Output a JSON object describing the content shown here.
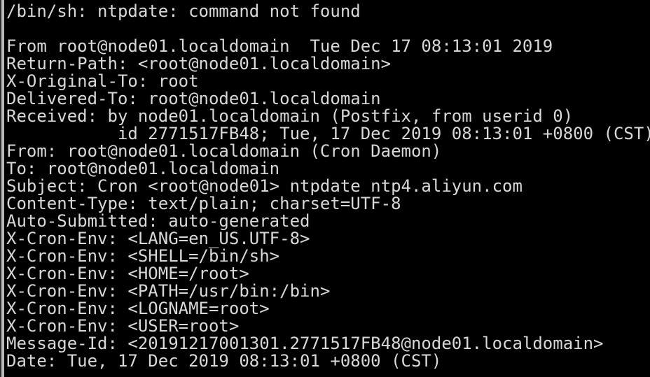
{
  "terminal": {
    "background_color": "#000000",
    "foreground_color": "#d8d8d8",
    "gutter_color": "#b8b8b8",
    "lines": [
      {
        "text": "/bin/sh: ntpdate: command not found",
        "name": "output-line-error"
      },
      {
        "text": "",
        "name": "output-line-blank"
      },
      {
        "text": "From root@node01.localdomain  Tue Dec 17 08:13:01 2019",
        "name": "output-line-from-envelope"
      },
      {
        "text": "Return-Path: <root@node01.localdomain>",
        "name": "output-line-return-path"
      },
      {
        "text": "X-Original-To: root",
        "name": "output-line-x-original-to"
      },
      {
        "text": "Delivered-To: root@node01.localdomain",
        "name": "output-line-delivered-to"
      },
      {
        "text": "Received: by node01.localdomain (Postfix, from userid 0)",
        "name": "output-line-received"
      },
      {
        "text": "           id 2771517FB48; Tue, 17 Dec 2019 08:13:01 +0800 (CST)",
        "name": "output-line-received-id"
      },
      {
        "text": "From: root@node01.localdomain (Cron Daemon)",
        "name": "output-line-from-header"
      },
      {
        "text": "To: root@node01.localdomain",
        "name": "output-line-to-header"
      },
      {
        "text": "Subject: Cron <root@node01> ntpdate ntp4.aliyun.com",
        "name": "output-line-subject"
      },
      {
        "text": "Content-Type: text/plain; charset=UTF-8",
        "name": "output-line-content-type"
      },
      {
        "text": "Auto-Submitted: auto-generated",
        "name": "output-line-auto-submitted"
      },
      {
        "text": "X-Cron-Env: <LANG=en_US.UTF-8>",
        "name": "output-line-cron-env-lang"
      },
      {
        "text": "X-Cron-Env: <SHELL=/bin/sh>",
        "name": "output-line-cron-env-shell"
      },
      {
        "text": "X-Cron-Env: <HOME=/root>",
        "name": "output-line-cron-env-home"
      },
      {
        "text": "X-Cron-Env: <PATH=/usr/bin:/bin>",
        "name": "output-line-cron-env-path"
      },
      {
        "text": "X-Cron-Env: <LOGNAME=root>",
        "name": "output-line-cron-env-logname"
      },
      {
        "text": "X-Cron-Env: <USER=root>",
        "name": "output-line-cron-env-user"
      },
      {
        "text": "Message-Id: <20191217001301.2771517FB48@node01.localdomain>",
        "name": "output-line-message-id"
      },
      {
        "text": "Date: Tue, 17 Dec 2019 08:13:01 +0800 (CST)",
        "name": "output-line-date"
      }
    ]
  }
}
